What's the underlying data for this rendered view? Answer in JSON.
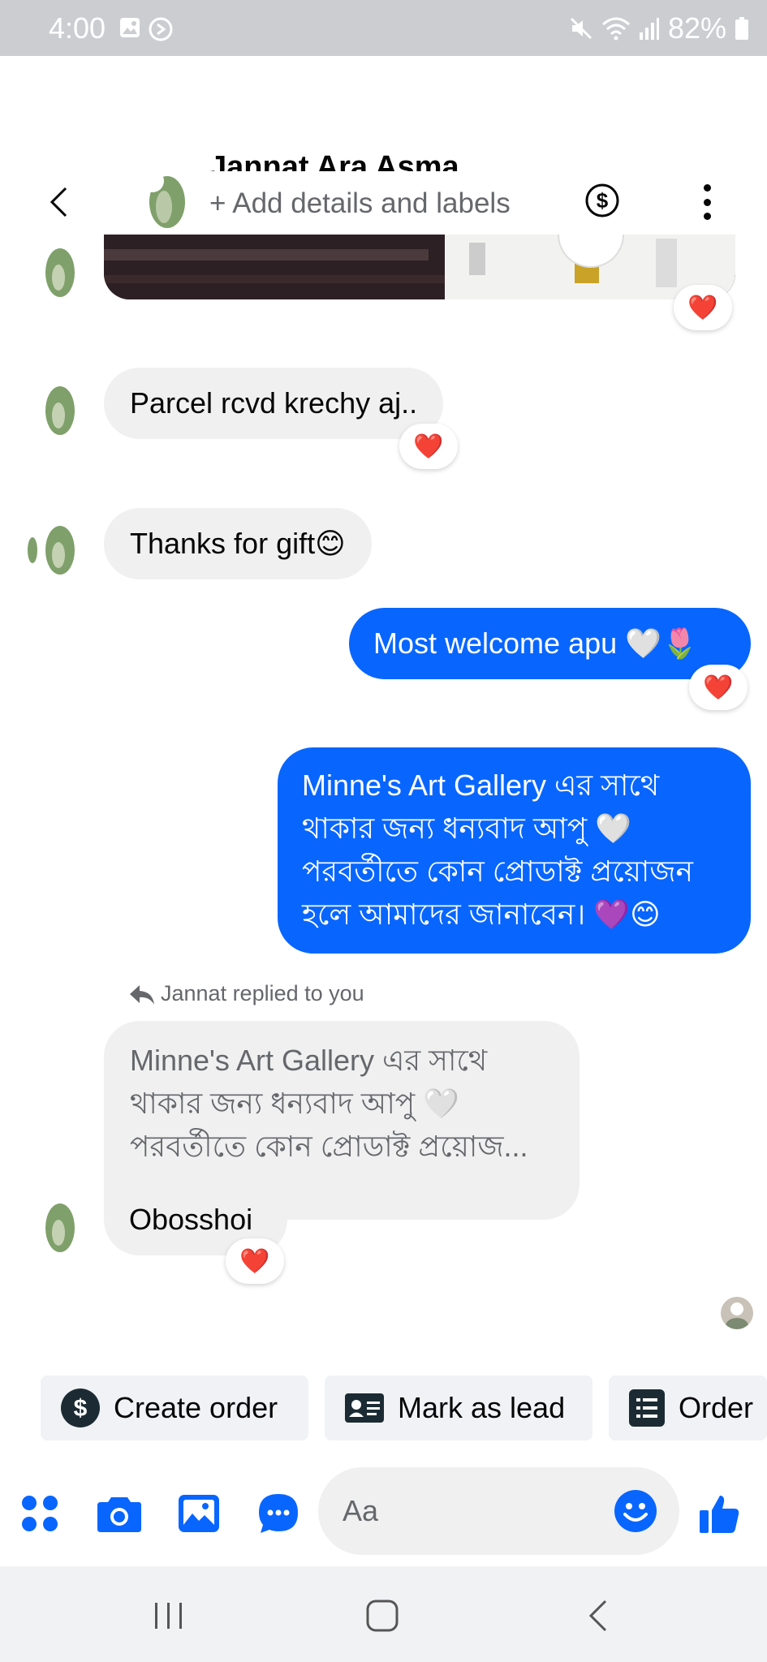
{
  "status_bar": {
    "time": "4:00",
    "battery": "82%"
  },
  "header": {
    "contact_name": "Jannat Ara Asma",
    "add_details": "+ Add details and labels"
  },
  "messages": {
    "m1": "Parcel rcvd krechy aj..",
    "m2": "Thanks for gift😊",
    "m3": "Most welcome apu 🤍🌷",
    "m4": "Minne's Art  Gallery  এর সাথে থাকার জন্য ধন্যবাদ আপু 🤍 পরবর্তীতে কোন প্রোডাক্ট প্রয়োজন হলে আমাদের জানাবেন। 💜😊",
    "reply_label": "Jannat replied to you",
    "quoted": "Minne's Art  Gallery  এর সাথে থাকার জন্য ধন্যবাদ আপু 🤍 পরবর্তীতে কোন প্রোডাক্ট প্রয়োজ...",
    "m5": "Obosshoi",
    "reaction": "❤️"
  },
  "actions": [
    {
      "label": "Create order",
      "icon": "dollar-circle-icon"
    },
    {
      "label": "Mark as lead",
      "icon": "id-card-icon"
    },
    {
      "label": "Order",
      "icon": "list-document-icon"
    }
  ],
  "composer": {
    "placeholder": "Aa"
  },
  "colors": {
    "accent": "#0866ff",
    "incoming_bubble": "#f0f0f0",
    "status_bar": "#cbcdd1",
    "reaction_heart": "#e41e3f"
  }
}
